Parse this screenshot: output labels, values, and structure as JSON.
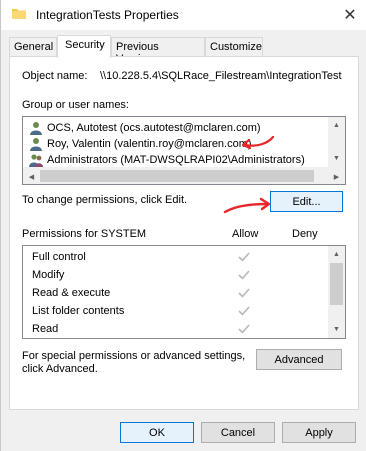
{
  "window": {
    "title": "IntegrationTests Properties",
    "close_glyph": "✕"
  },
  "tabs": [
    {
      "label": "General",
      "active": false
    },
    {
      "label": "Security",
      "active": true
    },
    {
      "label": "Previous Versions",
      "active": false
    },
    {
      "label": "Customize",
      "active": false
    }
  ],
  "security": {
    "object_name_label": "Object name:",
    "object_name_value": "\\\\10.228.5.4\\SQLRace_Filestream\\IntegrationTest",
    "group_label": "Group or user names:",
    "users": [
      {
        "name": "OCS, Autotest (ocs.autotest@mclaren.com)",
        "icon": "user-icon"
      },
      {
        "name": "Roy, Valentin (valentin.roy@mclaren.com)",
        "icon": "user-icon"
      },
      {
        "name": "Administrators (MAT-DWSQLRAPI02\\Administrators)",
        "icon": "group-icon"
      }
    ],
    "change_text": "To change permissions, click Edit.",
    "edit_button": "Edit...",
    "permissions_header": "Permissions for SYSTEM",
    "allow_header": "Allow",
    "deny_header": "Deny",
    "permissions": [
      {
        "name": "Full control",
        "allow": true,
        "deny": false
      },
      {
        "name": "Modify",
        "allow": true,
        "deny": false
      },
      {
        "name": "Read & execute",
        "allow": true,
        "deny": false
      },
      {
        "name": "List folder contents",
        "allow": true,
        "deny": false
      },
      {
        "name": "Read",
        "allow": true,
        "deny": false
      }
    ],
    "special_text_line1": "For special permissions or advanced settings,",
    "special_text_line2": "click Advanced.",
    "advanced_button": "Advanced"
  },
  "footer": {
    "ok": "OK",
    "cancel": "Cancel",
    "apply": "Apply"
  },
  "colors": {
    "annotation": "#e8262a",
    "focus_border": "#0078d7",
    "check_disabled": "#b8b8b8"
  }
}
